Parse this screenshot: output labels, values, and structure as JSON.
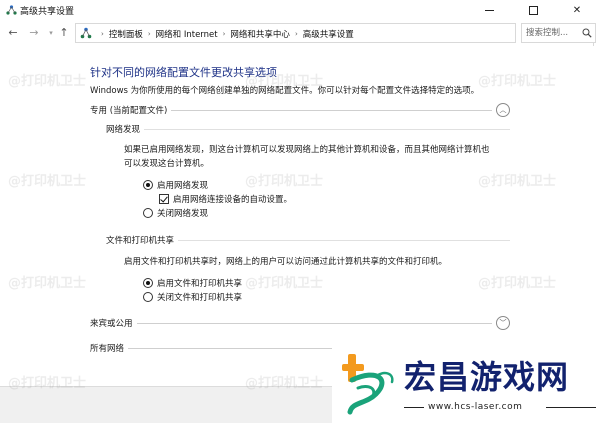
{
  "window": {
    "title": "高级共享设置"
  },
  "nav": {
    "breadcrumbs": [
      "控制面板",
      "网络和 Internet",
      "网络和共享中心",
      "高级共享设置"
    ],
    "search_placeholder": "搜索控制..."
  },
  "main": {
    "title": "针对不同的网络配置文件更改共享选项",
    "description": "Windows 为你所使用的每个网络创建单独的网络配置文件。你可以针对每个配置文件选择特定的选项。",
    "private_profile": {
      "label": "专用 (当前配置文件)",
      "expanded": true,
      "network_discovery": {
        "heading": "网络发现",
        "description_line1": "如果已启用网络发现，则这台计算机可以发现网络上的其他计算机和设备，而且其他网络计算机也",
        "description_line2": "可以发现这台计算机。",
        "option_on": "启用网络发现",
        "auto_setup": "启用网络连接设备的自动设置。",
        "option_off": "关闭网络发现"
      },
      "file_printer_sharing": {
        "heading": "文件和打印机共享",
        "description": "启用文件和打印机共享时，网络上的用户可以访问通过此计算机共享的文件和打印机。",
        "option_on": "启用文件和打印机共享",
        "option_off": "关闭文件和打印机共享"
      }
    },
    "guest_public": {
      "label": "来宾或公用",
      "expanded": false
    },
    "all_networks": {
      "label": "所有网络"
    }
  },
  "watermark": {
    "text": "@打印机卫士"
  },
  "logo": {
    "name": "宏昌游戏网",
    "url": "www.hcs-laser.com"
  },
  "colors": {
    "title_blue": "#1e3287",
    "logo_navy": "#12226e",
    "logo_green": "#1aa37a",
    "logo_orange": "#f39a1e"
  }
}
